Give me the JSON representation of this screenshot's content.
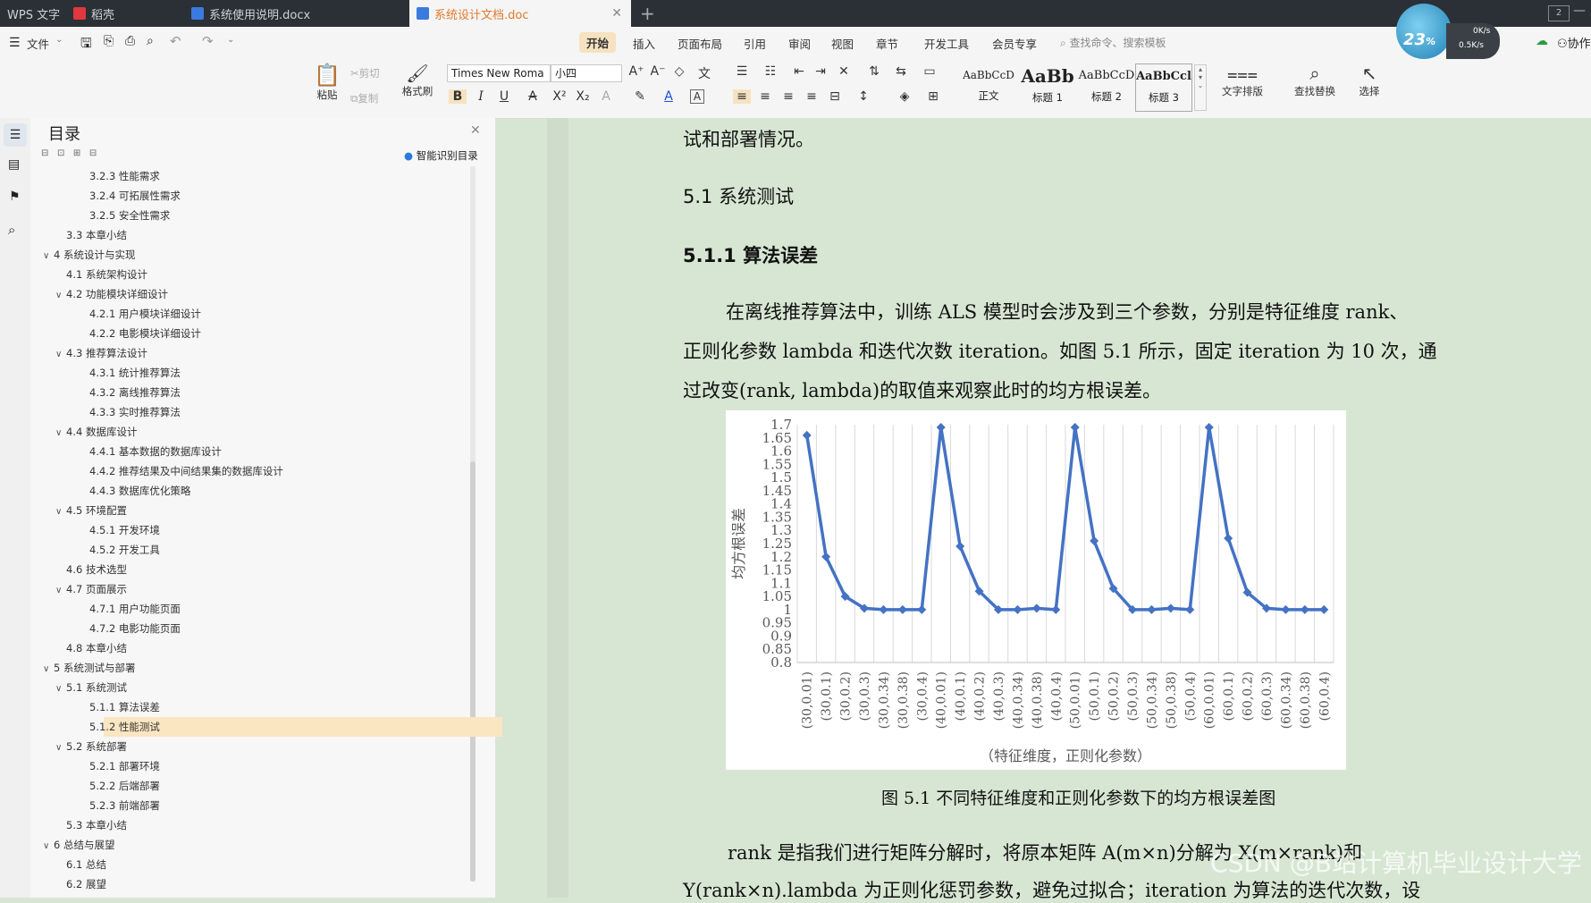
{
  "tabs": [
    {
      "label": "WPS 文字"
    },
    {
      "label": "稻壳"
    },
    {
      "label": "系统使用说明.docx"
    },
    {
      "label": "系统设计文档.doc"
    }
  ],
  "menu": {
    "file": "文件",
    "tabs": [
      "开始",
      "插入",
      "页面布局",
      "引用",
      "审阅",
      "视图",
      "章节",
      "开发工具",
      "会员专享"
    ],
    "search_placeholder": "查找命令、搜索模板",
    "collab": "协作"
  },
  "weather_widget": {
    "temp": "23",
    "unit": "%",
    "up": "0K/s",
    "down": "0.5K/s"
  },
  "ribbon": {
    "paste": "粘贴",
    "cut": "剪切",
    "copy": "复制",
    "format_painter": "格式刷",
    "font_name": "Times New Roma",
    "font_size": "小四",
    "styles": [
      {
        "preview": "AaBbCcD",
        "name": "正文"
      },
      {
        "preview": "AaBb",
        "name": "标题 1"
      },
      {
        "preview": "AaBbCcD",
        "name": "标题 2"
      },
      {
        "preview": "AaBbCcl",
        "name": "标题 3"
      }
    ],
    "text_layout": "文字排版",
    "find_replace": "查找替换",
    "select": "选择"
  },
  "toc": {
    "title": "目录",
    "smart": "智能识别目录",
    "items": [
      {
        "label": "3.2.3  性能需求",
        "level": 3,
        "caret": ""
      },
      {
        "label": "3.2.4  可拓展性需求",
        "level": 3,
        "caret": ""
      },
      {
        "label": "3.2.5  安全性需求",
        "level": 3,
        "caret": ""
      },
      {
        "label": "3.3  本章小结",
        "level": 2,
        "caret": ""
      },
      {
        "label": "4  系统设计与实现",
        "level": 1,
        "caret": "∨"
      },
      {
        "label": "4.1  系统架构设计",
        "level": 2,
        "caret": ""
      },
      {
        "label": "4.2  功能模块详细设计",
        "level": 2,
        "caret": "∨"
      },
      {
        "label": "4.2.1  用户模块详细设计",
        "level": 3,
        "caret": ""
      },
      {
        "label": "4.2.2  电影模块详细设计",
        "level": 3,
        "caret": ""
      },
      {
        "label": "4.3  推荐算法设计",
        "level": 2,
        "caret": "∨"
      },
      {
        "label": "4.3.1  统计推荐算法",
        "level": 3,
        "caret": ""
      },
      {
        "label": "4.3.2  离线推荐算法",
        "level": 3,
        "caret": ""
      },
      {
        "label": "4.3.3  实时推荐算法",
        "level": 3,
        "caret": ""
      },
      {
        "label": "4.4  数据库设计",
        "level": 2,
        "caret": "∨"
      },
      {
        "label": "4.4.1 基本数据的数据库设计",
        "level": 3,
        "caret": ""
      },
      {
        "label": "4.4.2 推荐结果及中间结果集的数据库设计",
        "level": 3,
        "caret": ""
      },
      {
        "label": "4.4.3  数据库优化策略",
        "level": 3,
        "caret": ""
      },
      {
        "label": "4.5  环境配置",
        "level": 2,
        "caret": "∨"
      },
      {
        "label": "4.5.1 开发环境",
        "level": 3,
        "caret": ""
      },
      {
        "label": "4.5.2 开发工具",
        "level": 3,
        "caret": ""
      },
      {
        "label": "4.6  技术选型",
        "level": 2,
        "caret": ""
      },
      {
        "label": "4.7  页面展示",
        "level": 2,
        "caret": "∨"
      },
      {
        "label": "4.7.1 用户功能页面",
        "level": 3,
        "caret": ""
      },
      {
        "label": "4.7.2 电影功能页面",
        "level": 3,
        "caret": ""
      },
      {
        "label": "4.8  本章小结",
        "level": 2,
        "caret": ""
      },
      {
        "label": "5  系统测试与部署",
        "level": 1,
        "caret": "∨"
      },
      {
        "label": "5.1  系统测试",
        "level": 2,
        "caret": "∨"
      },
      {
        "label": "5.1.1  算法误差",
        "level": 3,
        "caret": ""
      },
      {
        "label": "5.1.2  性能测试",
        "level": 3,
        "caret": "",
        "highlight": true
      },
      {
        "label": "5.2  系统部署",
        "level": 2,
        "caret": "∨"
      },
      {
        "label": "5.2.1  部署环境",
        "level": 3,
        "caret": ""
      },
      {
        "label": "5.2.2  后端部署",
        "level": 3,
        "caret": ""
      },
      {
        "label": "5.2.3  前端部署",
        "level": 3,
        "caret": ""
      },
      {
        "label": "5.3  本章小结",
        "level": 2,
        "caret": ""
      },
      {
        "label": "6  总结与展望",
        "level": 1,
        "caret": "∨"
      },
      {
        "label": "6.1  总结",
        "level": 2,
        "caret": ""
      },
      {
        "label": "6.2  展望",
        "level": 2,
        "caret": ""
      }
    ]
  },
  "doc": {
    "line0": "试和部署情况。",
    "h2": "5.1  系统测试",
    "h3": "5.1.1  算法误差",
    "p1_l1": "在离线推荐算法中，训练 ALS 模型时会涉及到三个参数，分别是特征维度 rank、",
    "p1_l2": "正则化参数 lambda 和迭代次数 iteration。如图 5.1 所示，固定 iteration 为 10 次，通",
    "p1_l3": "过改变(rank, lambda)的取值来观察此时的均方根误差。",
    "caption": "图 5.1  不同特征维度和正则化参数下的均方根误差图",
    "p2_l1": "rank 是指我们进行矩阵分解时，将原本矩阵 A(m×n)分解为 X(m×rank)和",
    "p2_l2": "Y(rank×n).lambda 为正则化惩罚参数，避免过拟合；iteration 为算法的迭代次数，设",
    "watermark": "CSDN @B站计算机毕业设计大学"
  },
  "chart_data": {
    "type": "line",
    "xlabel": "（特征维度，正则化参数）",
    "ylabel": "均方根误差",
    "ylim": [
      0.8,
      1.7
    ],
    "yticks": [
      "1.7",
      "1.65",
      "1.6",
      "1.55",
      "1.5",
      "1.45",
      "1.4",
      "1.35",
      "1.3",
      "1.25",
      "1.2",
      "1.15",
      "1.1",
      "1.05",
      "1",
      "0.95",
      "0.9",
      "0.85",
      "0.8"
    ],
    "color": "#4472c4",
    "categories": [
      "(30,0.01)",
      "(30,0.1)",
      "(30,0.2)",
      "(30,0.3)",
      "(30,0.34)",
      "(30,0.38)",
      "(30,0.4)",
      "(40,0.01)",
      "(40,0.1)",
      "(40,0.2)",
      "(40,0.3)",
      "(40,0.34)",
      "(40,0.38)",
      "(40,0.4)",
      "(50,0.01)",
      "(50,0.1)",
      "(50,0.2)",
      "(50,0.3)",
      "(50,0.34)",
      "(50,0.38)",
      "(50,0.4)",
      "(60,0.01)",
      "(60,0.1)",
      "(60,0.2)",
      "(60,0.3)",
      "(60,0.34)",
      "(60,0.38)",
      "(60,0.4)"
    ],
    "values": [
      1.66,
      1.2,
      1.05,
      1.005,
      1.0,
      1.0,
      1.0,
      1.69,
      1.24,
      1.07,
      1.0,
      1.0,
      1.005,
      1.0,
      1.69,
      1.26,
      1.08,
      1.0,
      1.0,
      1.005,
      1.0,
      1.69,
      1.27,
      1.065,
      1.005,
      1.0,
      1.0,
      1.0
    ],
    "grid": true
  }
}
